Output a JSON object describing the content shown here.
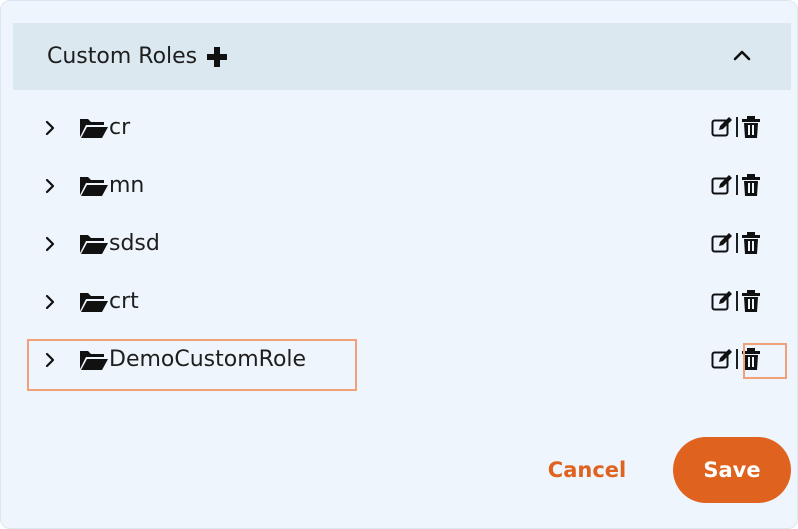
{
  "panel": {
    "title": "Custom Roles",
    "add_icon": "plus-icon",
    "collapse_icon": "chevron-up-icon"
  },
  "roles": [
    {
      "name": "cr"
    },
    {
      "name": "mn"
    },
    {
      "name": "sdsd"
    },
    {
      "name": "crt"
    },
    {
      "name": "DemoCustomRole"
    }
  ],
  "icons": {
    "expand": "chevron-right-icon",
    "folder": "folder-open-icon",
    "edit": "edit-icon",
    "delete": "trash-icon"
  },
  "footer": {
    "cancel_label": "Cancel",
    "save_label": "Save"
  },
  "colors": {
    "accent": "#e0621f",
    "panel_bg": "#eef5fd",
    "header_bg": "#dbe8ef",
    "highlight": "#f2a07a"
  }
}
